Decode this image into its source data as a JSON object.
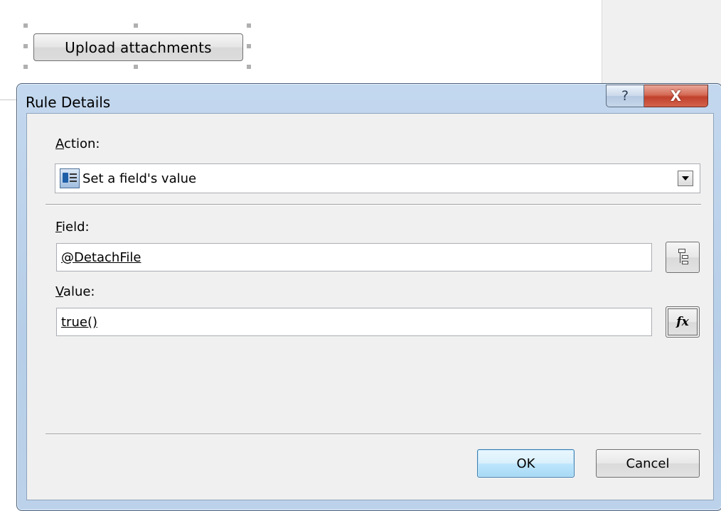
{
  "form": {
    "upload_button_label": "Upload attachments"
  },
  "dialog": {
    "title": "Rule Details",
    "help_label": "?",
    "close_label": "X",
    "action": {
      "label_accesskey": "A",
      "label_rest": "ction:",
      "selected_value": "Set a field's value",
      "icon": "set-field-value-icon"
    },
    "field": {
      "label_accesskey": "F",
      "label_rest": "ield:",
      "value": "@DetachFile",
      "picker_icon": "tree-icon"
    },
    "value": {
      "label_accesskey": "V",
      "label_rest": "alue:",
      "value": "true()",
      "formula_icon_text": "fx"
    },
    "ok_label": "OK",
    "cancel_label": "Cancel"
  },
  "colors": {
    "frame": "#bcd2ea",
    "client": "#f0f0f0",
    "close_button": "#c0412c",
    "ok_button": "#bee6fd"
  }
}
